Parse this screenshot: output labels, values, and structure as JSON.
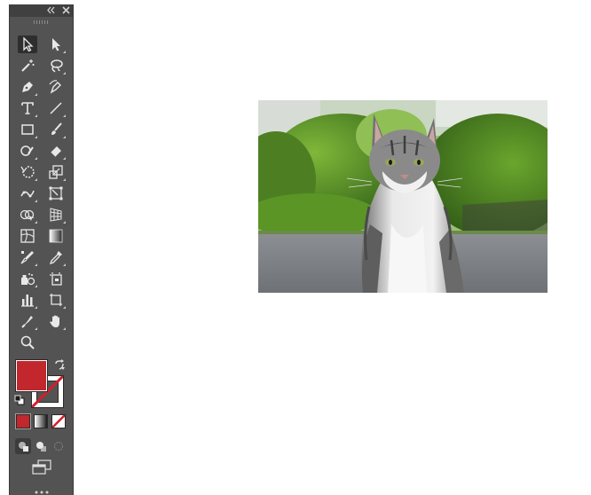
{
  "tools": [
    {
      "name": "selection-tool",
      "icon": "arrow-icon",
      "active": true
    },
    {
      "name": "direct-selection-tool",
      "icon": "direct-arrow-icon"
    },
    {
      "name": "magic-wand-tool",
      "icon": "magic-wand-icon"
    },
    {
      "name": "lasso-tool",
      "icon": "lasso-icon"
    },
    {
      "name": "pen-tool",
      "icon": "pen-icon"
    },
    {
      "name": "curvature-tool",
      "icon": "curvature-pen-icon"
    },
    {
      "name": "type-tool",
      "icon": "type-icon"
    },
    {
      "name": "line-segment-tool",
      "icon": "line-icon"
    },
    {
      "name": "rectangle-tool",
      "icon": "rectangle-icon"
    },
    {
      "name": "paintbrush-tool",
      "icon": "brush-icon"
    },
    {
      "name": "shaper-tool",
      "icon": "shaper-icon"
    },
    {
      "name": "eraser-tool",
      "icon": "eraser-icon"
    },
    {
      "name": "rotate-tool",
      "icon": "rotate-icon"
    },
    {
      "name": "scale-tool",
      "icon": "scale-icon"
    },
    {
      "name": "puppet-warp-tool",
      "icon": "puppet-warp-icon"
    },
    {
      "name": "free-transform-tool",
      "icon": "free-transform-icon"
    },
    {
      "name": "shape-builder-tool",
      "icon": "shape-builder-icon"
    },
    {
      "name": "perspective-grid-tool",
      "icon": "perspective-grid-icon"
    },
    {
      "name": "mesh-tool",
      "icon": "mesh-icon"
    },
    {
      "name": "gradient-tool",
      "icon": "gradient-icon"
    },
    {
      "name": "blend-tool",
      "icon": "blend-icon"
    },
    {
      "name": "eyedropper-tool",
      "icon": "eyedropper-icon"
    },
    {
      "name": "symbol-sprayer-tool",
      "icon": "symbol-sprayer-icon"
    },
    {
      "name": "artboard-tool",
      "icon": "artboard-icon"
    },
    {
      "name": "column-graph-tool",
      "icon": "column-graph-icon"
    },
    {
      "name": "slice-tool",
      "icon": "slice-icon"
    },
    {
      "name": "knife-tool",
      "icon": "knife-icon"
    },
    {
      "name": "hand-tool",
      "icon": "hand-icon"
    },
    {
      "name": "zoom-tool",
      "icon": "zoom-icon"
    }
  ],
  "colors": {
    "fill": "#c1272d",
    "stroke": "#ffffff",
    "panel": "#535353",
    "none_slash": "#d0202a"
  },
  "color_modes": [
    "color-mode",
    "gradient-mode",
    "none-mode"
  ],
  "drawing_modes": [
    "draw-normal",
    "draw-behind",
    "draw-inside"
  ],
  "canvas": {
    "image": "placed-photo-cat"
  }
}
